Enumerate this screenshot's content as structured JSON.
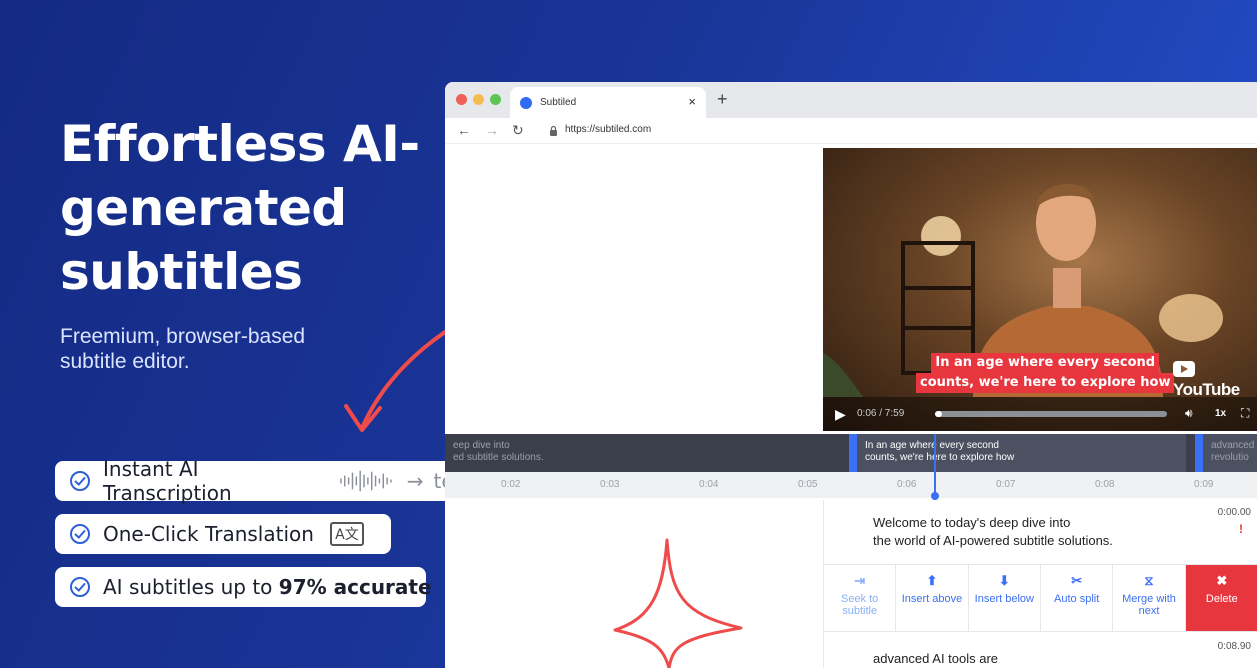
{
  "hero": {
    "title": "Effortless AI-generated subtitles",
    "subtitle": "Freemium, browser-based subtitle editor."
  },
  "features": [
    {
      "label": "Instant AI Transcription",
      "suffix": "text"
    },
    {
      "label": "One-Click Translation",
      "icon": "translate-icon",
      "icon_text": "A文"
    },
    {
      "label_prefix": "AI subtitles up to ",
      "label_bold": "97% accurate"
    }
  ],
  "browser": {
    "tab_title": "Subtiled",
    "url": "https://subtiled.com",
    "new_tab": "+",
    "tab_close": "×"
  },
  "video": {
    "caption_line1": "In an age where every second",
    "caption_line2": "counts, we're here to explore how",
    "brand": "YouTube",
    "time": "0:06 / 7:59",
    "speed": "1x",
    "progress": 0.013
  },
  "timeline": {
    "segments": [
      {
        "line1": "eep dive into",
        "line2": "ed subtitle solutions."
      },
      {
        "line1": "In an age where every second",
        "line2": "counts, we're here to explore how"
      },
      {
        "line1": "advanced",
        "line2": "revolutio"
      }
    ],
    "ticks": [
      "0:02",
      "0:03",
      "0:04",
      "0:05",
      "0:06",
      "0:07",
      "0:08",
      "0:09"
    ]
  },
  "editor": {
    "entry1_line1": "Welcome to today's deep dive into",
    "entry1_line2": "the world of AI-powered subtitle solutions.",
    "entry1_time": "0:00.00",
    "warning": "!",
    "entry2_text": "advanced AI tools are",
    "entry2_time": "0:08.90",
    "tools": [
      {
        "label": "Seek to subtitle",
        "icon": "seek-icon"
      },
      {
        "label": "Insert above",
        "icon": "insert-above-icon"
      },
      {
        "label": "Insert below",
        "icon": "insert-below-icon"
      },
      {
        "label": "Auto split",
        "icon": "scissors-icon"
      },
      {
        "label": "Merge with next",
        "icon": "merge-icon"
      },
      {
        "label": "Delete",
        "icon": "delete-icon"
      }
    ]
  },
  "colors": {
    "background": "#1a3598",
    "accent": "#3b6ff5",
    "caption_bg": "#e8363f",
    "delete_bg": "#e8363f",
    "doodle": "#f04b4b"
  }
}
